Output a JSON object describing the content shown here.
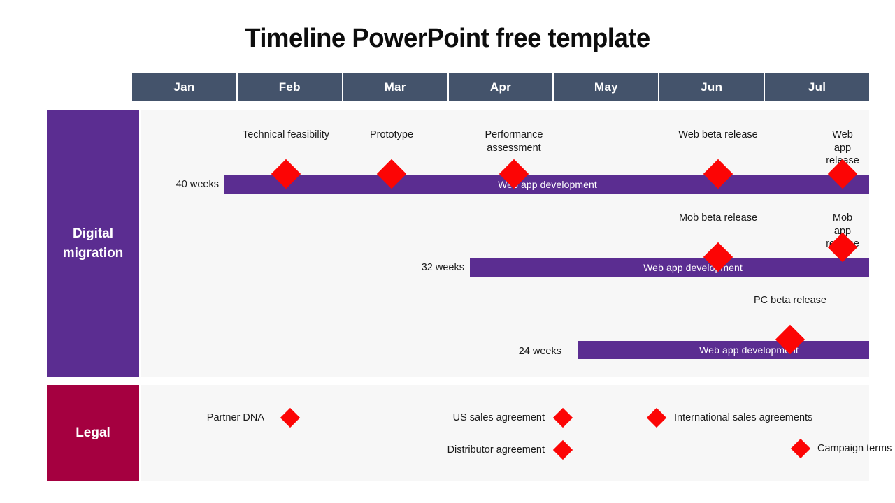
{
  "title": "Timeline PowerPoint free template",
  "colors": {
    "month_header": "#44536b",
    "digital_sidebar": "#5b2d91",
    "legal_sidebar": "#a50040",
    "bar": "#5b2d91",
    "milestone_marker": "#fc0505",
    "panel_background": "#f7f7f7"
  },
  "months": [
    {
      "label": "Jan"
    },
    {
      "label": "Feb"
    },
    {
      "label": "Mar"
    },
    {
      "label": "Apr"
    },
    {
      "label": "May"
    },
    {
      "label": "Jun"
    },
    {
      "label": "Jul"
    }
  ],
  "sections": [
    {
      "id": "digital-migration",
      "label": "Digital\nmigration",
      "rows": [
        {
          "duration": "40 weeks",
          "bar_label": "Web app development",
          "milestones": [
            {
              "label": "Technical feasibility"
            },
            {
              "label": "Prototype"
            },
            {
              "label": "Performance\nassessment"
            },
            {
              "label": "Web beta release"
            },
            {
              "label": "Web app release"
            }
          ]
        },
        {
          "duration": "32 weeks",
          "bar_label": "Web app development",
          "milestones": [
            {
              "label": "Mob beta release"
            },
            {
              "label": "Mob app release"
            }
          ]
        },
        {
          "duration": "24 weeks",
          "bar_label": "Web app development",
          "milestones": [
            {
              "label": "PC beta release"
            }
          ]
        }
      ]
    },
    {
      "id": "legal",
      "label": "Legal",
      "items": [
        {
          "label": "Partner DNA"
        },
        {
          "label": "US sales agreement"
        },
        {
          "label": "International sales agreements"
        },
        {
          "label": "Distributor agreement"
        },
        {
          "label": "Campaign terms"
        }
      ]
    }
  ]
}
